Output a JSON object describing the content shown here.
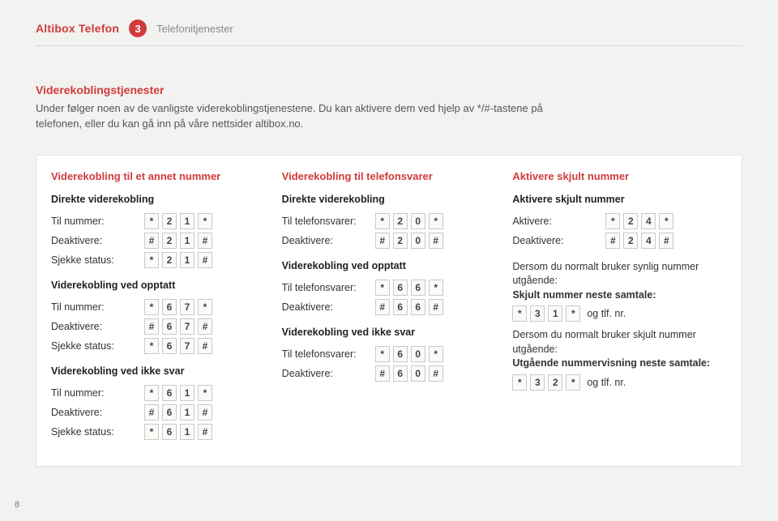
{
  "header": {
    "brand": "Altibox Telefon",
    "badge": "3",
    "section": "Telefonitjenester"
  },
  "page_number": "8",
  "intro": {
    "title": "Viderekoblingstjenester",
    "body": "Under følger noen av de vanligste viderekoblingstjenestene. Du kan aktivere dem ved hjelp av */#-tastene på telefonen, eller du kan gå inn på våre nettsider altibox.no."
  },
  "col1": {
    "title": "Viderekobling til et annet nummer",
    "g1": {
      "head": "Direkte viderekobling",
      "rows": [
        {
          "label": "Til nummer:",
          "keys": [
            "*",
            "2",
            "1",
            "*"
          ]
        },
        {
          "label": "Deaktivere:",
          "keys": [
            "#",
            "2",
            "1",
            "#"
          ]
        },
        {
          "label": "Sjekke status:",
          "keys": [
            "*",
            "2",
            "1",
            "#"
          ]
        }
      ]
    },
    "g2": {
      "head": "Viderekobling ved opptatt",
      "rows": [
        {
          "label": "Til nummer:",
          "keys": [
            "*",
            "6",
            "7",
            "*"
          ]
        },
        {
          "label": "Deaktivere:",
          "keys": [
            "#",
            "6",
            "7",
            "#"
          ]
        },
        {
          "label": "Sjekke status:",
          "keys": [
            "*",
            "6",
            "7",
            "#"
          ]
        }
      ]
    },
    "g3": {
      "head": "Viderekobling ved ikke svar",
      "rows": [
        {
          "label": "Til nummer:",
          "keys": [
            "*",
            "6",
            "1",
            "*"
          ]
        },
        {
          "label": "Deaktivere:",
          "keys": [
            "#",
            "6",
            "1",
            "#"
          ]
        },
        {
          "label": "Sjekke status:",
          "keys": [
            "*",
            "6",
            "1",
            "#"
          ]
        }
      ]
    }
  },
  "col2": {
    "title": "Viderekobling til telefonsvarer",
    "g1": {
      "head": "Direkte viderekobling",
      "rows": [
        {
          "label": "Til telefonsvarer:",
          "keys": [
            "*",
            "2",
            "0",
            "*"
          ]
        },
        {
          "label": "Deaktivere:",
          "keys": [
            "#",
            "2",
            "0",
            "#"
          ]
        }
      ]
    },
    "g2": {
      "head": "Viderekobling ved opptatt",
      "rows": [
        {
          "label": "Til telefonsvarer:",
          "keys": [
            "*",
            "6",
            "6",
            "*"
          ]
        },
        {
          "label": "Deaktivere:",
          "keys": [
            "#",
            "6",
            "6",
            "#"
          ]
        }
      ]
    },
    "g3": {
      "head": "Viderekobling ved ikke svar",
      "rows": [
        {
          "label": "Til telefonsvarer:",
          "keys": [
            "*",
            "6",
            "0",
            "*"
          ]
        },
        {
          "label": "Deaktivere:",
          "keys": [
            "#",
            "6",
            "0",
            "#"
          ]
        }
      ]
    }
  },
  "col3": {
    "title": "Aktivere skjult nummer",
    "g1": {
      "head": "Aktivere skjult nummer",
      "rows": [
        {
          "label": "Aktivere:",
          "keys": [
            "*",
            "2",
            "4",
            "*"
          ]
        },
        {
          "label": "Deaktivere:",
          "keys": [
            "#",
            "2",
            "4",
            "#"
          ]
        }
      ]
    },
    "note1_pre": "Dersom du normalt bruker synlig nummer utgående:",
    "note1_em": "Skjult nummer neste samtale:",
    "note1_keys": [
      "*",
      "3",
      "1",
      "*"
    ],
    "note1_suffix": "og tlf. nr.",
    "note2_pre": "Dersom du normalt bruker skjult nummer utgående:",
    "note2_em": "Utgående nummervisning neste samtale:",
    "note2_keys": [
      "*",
      "3",
      "2",
      "*"
    ],
    "note2_suffix": "og tlf. nr."
  }
}
